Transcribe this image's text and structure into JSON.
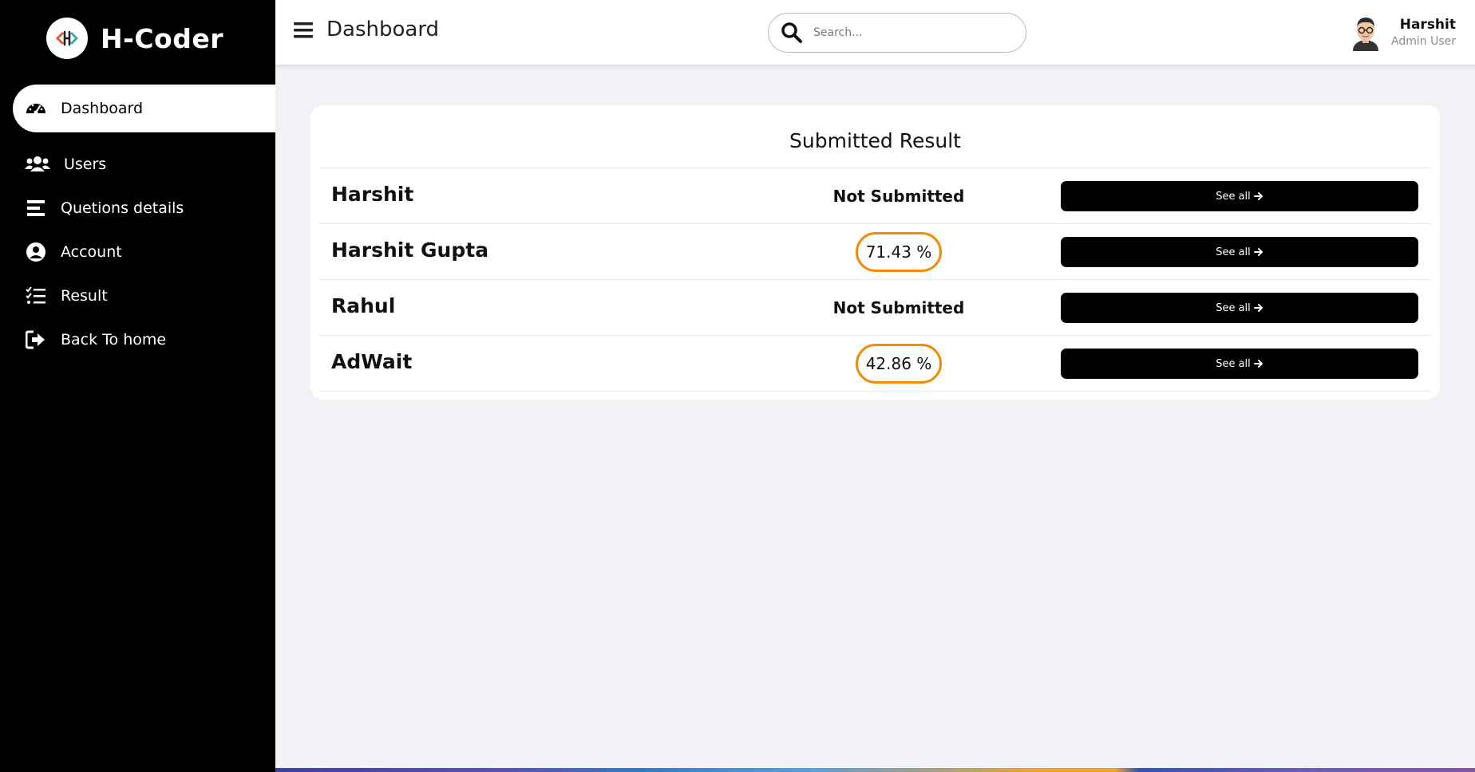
{
  "app": {
    "brand_name": "H-Coder"
  },
  "sidebar": {
    "items": [
      {
        "label": "Dashboard",
        "icon": "dashboard-gauge-icon",
        "active": true
      },
      {
        "label": "Users",
        "icon": "users-icon",
        "active": false
      },
      {
        "label": "Quetions details",
        "icon": "list-lines-icon",
        "active": false
      },
      {
        "label": "Account",
        "icon": "user-circle-icon",
        "active": false
      },
      {
        "label": "Result",
        "icon": "checklist-icon",
        "active": false
      },
      {
        "label": "Back To home",
        "icon": "sign-out-icon",
        "active": false
      }
    ]
  },
  "header": {
    "title": "Dashboard",
    "search_placeholder": "Search...",
    "search_value": "",
    "user_name": "Harshit",
    "user_role": "Admin User"
  },
  "results_card": {
    "title": "Submitted Result",
    "button_label": "See all",
    "rows": [
      {
        "name": "Harshit",
        "status": "Not Submitted",
        "score": null
      },
      {
        "name": "Harshit Gupta",
        "status": null,
        "score": "71.43 %"
      },
      {
        "name": "Rahul",
        "status": "Not Submitted",
        "score": null
      },
      {
        "name": "AdWait",
        "status": null,
        "score": "42.86 %"
      }
    ]
  },
  "colors": {
    "sidebar_bg": "#000000",
    "accent_orange": "#f28a0a",
    "button_bg": "#000000",
    "page_bg": "#f0f2f6"
  }
}
